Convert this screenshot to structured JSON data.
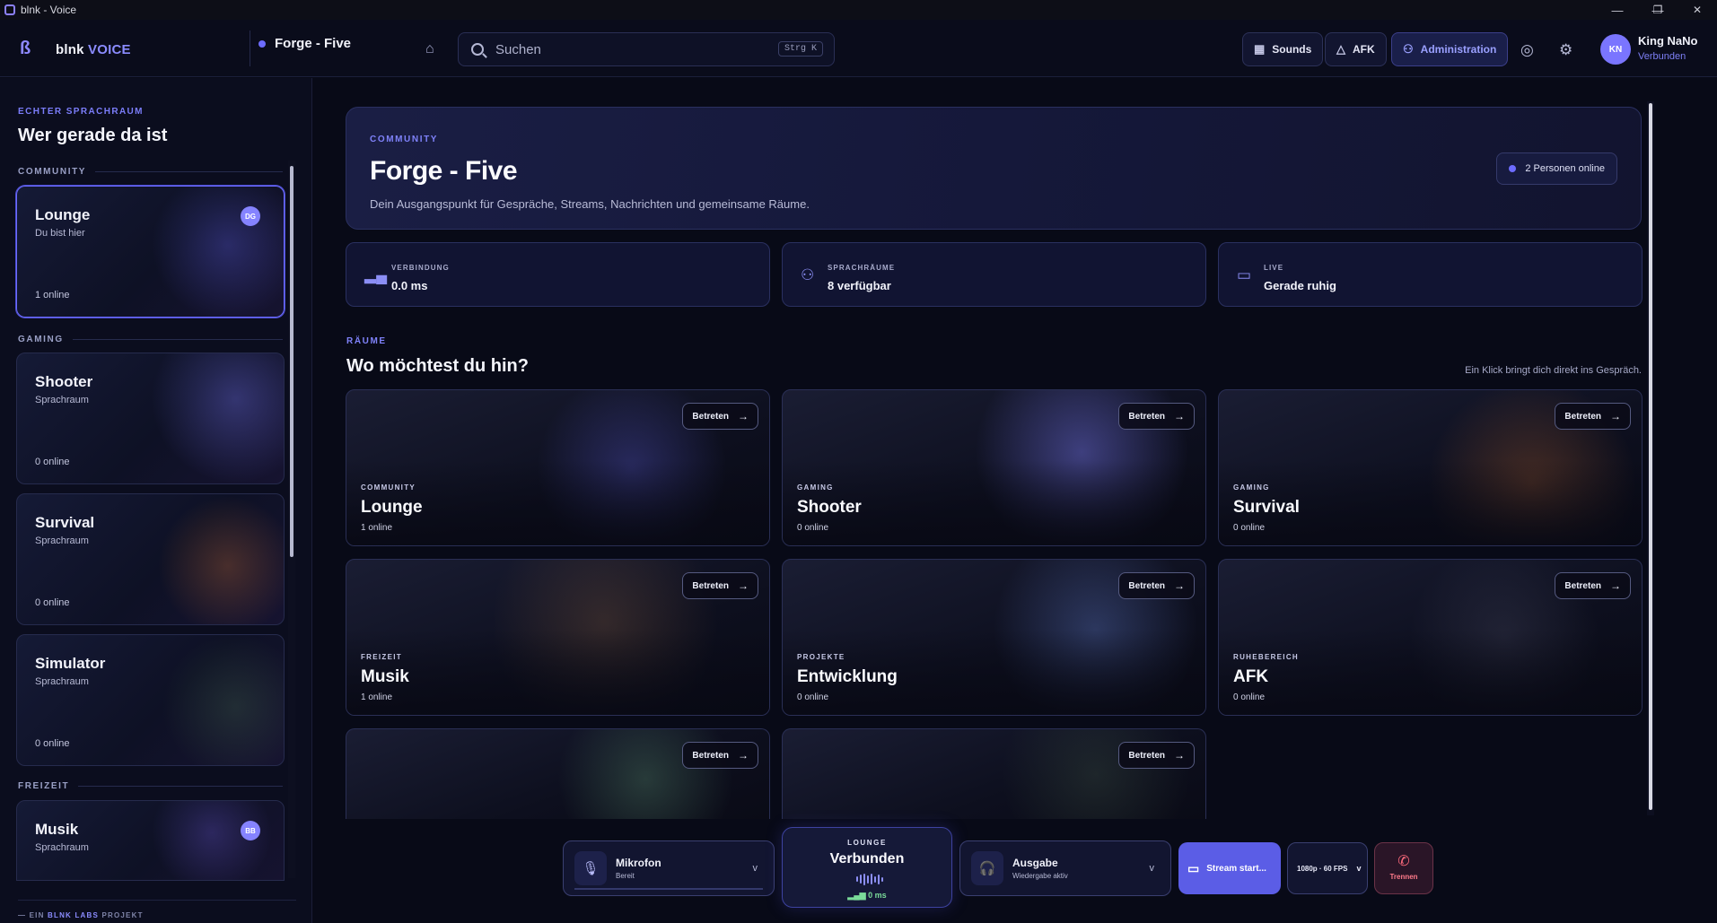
{
  "window": {
    "title": "blnk - Voice",
    "min": "—",
    "max": "❐",
    "close": "✕"
  },
  "topbar": {
    "brand_main": "blnk",
    "brand_accent": "VOICE",
    "server_name": "Forge - Five",
    "home_glyph": "⌂",
    "search_placeholder": "Suchen",
    "search_shortcut": "Strg K",
    "sounds_label": "Sounds",
    "afk_label": "AFK",
    "admin_label": "Administration",
    "user_initials": "KN",
    "user_name": "King NaNo",
    "user_status": "Verbunden"
  },
  "sidebar": {
    "kicker": "ECHTER SPRACHRAUM",
    "title": "Wer gerade da ist",
    "sections": [
      "COMMUNITY",
      "GAMING",
      "FREIZEIT"
    ],
    "rooms": [
      {
        "name": "Lounge",
        "sub": "Du bist hier",
        "online": "1 online",
        "badge": "DG"
      },
      {
        "name": "Shooter",
        "sub": "Sprachraum",
        "online": "0 online"
      },
      {
        "name": "Survival",
        "sub": "Sprachraum",
        "online": "0 online"
      },
      {
        "name": "Simulator",
        "sub": "Sprachraum",
        "online": "0 online"
      },
      {
        "name": "Musik",
        "sub": "Sprachraum",
        "badge": "BB"
      }
    ],
    "footer_prefix": "EIN",
    "footer_accent": "BLNK LABS",
    "footer_suffix": "PROJEKT"
  },
  "hero": {
    "kicker": "COMMUNITY",
    "title": "Forge - Five",
    "description": "Dein Ausgangspunkt für Gespräche, Streams, Nachrichten und gemeinsame Räume.",
    "online_pill": "2 Personen online"
  },
  "stats": [
    {
      "label": "VERBINDUNG",
      "value": "0.0 ms"
    },
    {
      "label": "SPRACHRÄUME",
      "value": "8 verfügbar"
    },
    {
      "label": "LIVE",
      "value": "Gerade ruhig"
    }
  ],
  "rooms_section": {
    "kicker": "RÄUME",
    "title": "Wo möchtest du hin?",
    "hint": "Ein Klick bringt dich direkt ins Gespräch.",
    "join_label": "Betreten",
    "join_arrow": "→"
  },
  "rooms": [
    {
      "category": "COMMUNITY",
      "name": "Lounge",
      "online": "1 online"
    },
    {
      "category": "GAMING",
      "name": "Shooter",
      "online": "0 online"
    },
    {
      "category": "GAMING",
      "name": "Survival",
      "online": "0 online"
    },
    {
      "category": "FREIZEIT",
      "name": "Musik",
      "online": "1 online"
    },
    {
      "category": "PROJEKTE",
      "name": "Entwicklung",
      "online": "0 online"
    },
    {
      "category": "RUHEBEREICH",
      "name": "AFK",
      "online": "0 online"
    }
  ],
  "bottombar": {
    "mic_title": "Mikrofon",
    "mic_status": "Bereit",
    "channel_kicker": "LOUNGE",
    "channel_state": "Verbunden",
    "channel_ping": "0 ms",
    "out_title": "Ausgabe",
    "out_status": "Wiedergabe aktiv",
    "stream_label": "Stream start...",
    "quality_label": "1080p · 60 FPS",
    "hangup_label": "Trennen",
    "chevron": "v"
  },
  "colors": {
    "accent": "#6d6cff",
    "background": "#080a17",
    "danger": "#ff6b7d"
  }
}
